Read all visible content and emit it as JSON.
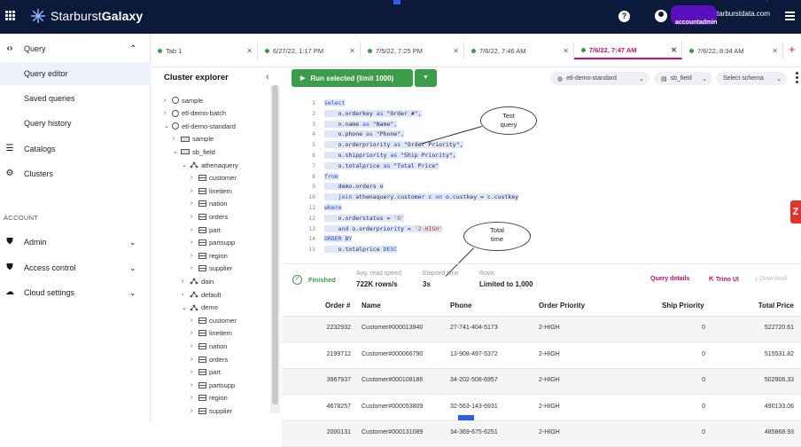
{
  "header": {
    "brand_light": "Starburst",
    "brand_bold": "Galaxy",
    "help": "?",
    "email_domain": "tarburstdata.com",
    "account": "accountadmin"
  },
  "sidebar": {
    "items": [
      {
        "label": "Query",
        "icon": "code-icon"
      },
      {
        "label": "Query editor"
      },
      {
        "label": "Saved queries"
      },
      {
        "label": "Query history"
      },
      {
        "label": "Catalogs",
        "icon": "catalogs-icon"
      },
      {
        "label": "Clusters",
        "icon": "clusters-icon"
      }
    ],
    "section": "ACCOUNT",
    "account_items": [
      {
        "label": "Admin",
        "icon": "shield-icon"
      },
      {
        "label": "Access control",
        "icon": "shield-icon"
      },
      {
        "label": "Cloud settings",
        "icon": "cloud-icon"
      }
    ]
  },
  "tabs": [
    {
      "label": "Tab 1"
    },
    {
      "label": "6/27/22, 1:17 PM"
    },
    {
      "label": "7/5/22, 7:25 PM"
    },
    {
      "label": "7/6/22, 7:46 AM"
    },
    {
      "label": "7/6/22, 7:47 AM"
    },
    {
      "label": "7/6/22, 8:34 AM"
    }
  ],
  "explorer": {
    "title": "Cluster explorer",
    "tree": [
      {
        "label": "sample",
        "icon": "catalog-icon",
        "level": 0,
        "exp": "›"
      },
      {
        "label": "etl-demo-batch",
        "icon": "catalog-icon",
        "level": 0,
        "exp": "›"
      },
      {
        "label": "etl-demo-standard",
        "icon": "catalog-icon",
        "level": 0,
        "exp": "⌄"
      },
      {
        "label": "sample",
        "icon": "schema-icon",
        "level": 1,
        "exp": "›"
      },
      {
        "label": "sb_field",
        "icon": "schema-icon",
        "level": 1,
        "exp": "⌄"
      },
      {
        "label": "athenaquery",
        "icon": "folder-icon",
        "level": 2,
        "exp": "⌄"
      },
      {
        "label": "customer",
        "icon": "table-icon",
        "level": 3,
        "exp": "›"
      },
      {
        "label": "lineitem",
        "icon": "table-icon",
        "level": 3,
        "exp": "›"
      },
      {
        "label": "nation",
        "icon": "table-icon",
        "level": 3,
        "exp": "›"
      },
      {
        "label": "orders",
        "icon": "table-icon",
        "level": 3,
        "exp": "›"
      },
      {
        "label": "part",
        "icon": "table-icon",
        "level": 3,
        "exp": "›"
      },
      {
        "label": "partsupp",
        "icon": "table-icon",
        "level": 3,
        "exp": "›"
      },
      {
        "label": "region",
        "icon": "table-icon",
        "level": 3,
        "exp": "›"
      },
      {
        "label": "supplier",
        "icon": "table-icon",
        "level": 3,
        "exp": "›"
      },
      {
        "label": "dain",
        "icon": "folder-icon",
        "level": 2,
        "exp": "›"
      },
      {
        "label": "default",
        "icon": "folder-icon",
        "level": 2,
        "exp": "›"
      },
      {
        "label": "demo",
        "icon": "folder-icon",
        "level": 2,
        "exp": "⌄"
      },
      {
        "label": "customer",
        "icon": "table-icon",
        "level": 3,
        "exp": "›"
      },
      {
        "label": "lineitem",
        "icon": "table-icon",
        "level": 3,
        "exp": "›"
      },
      {
        "label": "nation",
        "icon": "table-icon",
        "level": 3,
        "exp": "›"
      },
      {
        "label": "orders",
        "icon": "table-icon",
        "level": 3,
        "exp": "›"
      },
      {
        "label": "part",
        "icon": "table-icon",
        "level": 3,
        "exp": "›"
      },
      {
        "label": "partsupp",
        "icon": "table-icon",
        "level": 3,
        "exp": "›"
      },
      {
        "label": "region",
        "icon": "table-icon",
        "level": 3,
        "exp": "›"
      },
      {
        "label": "supplier",
        "icon": "table-icon",
        "level": 3,
        "exp": "›"
      }
    ]
  },
  "toolbar": {
    "run_label": "Run selected (limit 1000)",
    "cluster": "etl-demo-standard",
    "catalog": "sb_field",
    "schema_placeholder": "Select schema"
  },
  "editor": {
    "lines": [
      "select",
      "    o.orderkey as \"Order #\",",
      "    o.name as \"Name\",",
      "    o.phone as \"Phone\",",
      "    o.orderpriority as \"Order Priority\",",
      "    o.shippriority as \"Ship Priority\",",
      "    o.totalprice as \"Total Price\"",
      "from",
      "    demo.orders o",
      "    join athenaquery.customer c on o.custkey = c.custkey",
      "where",
      "    o.orderstatus = 'O'",
      "    and o.orderpriority = '2-HIGH'",
      "ORDER BY",
      "    o.totalprice DESC"
    ],
    "callout_query": "Test query",
    "callout_time": "Total time"
  },
  "status": {
    "state": "Finished",
    "speed_label": "Avg. read speed",
    "speed_value": "722K rows/s",
    "elapsed_label": "Elapsed time",
    "elapsed_value": "3s",
    "rows_label": "Rows",
    "rows_value": "Limited to 1,000",
    "query_details": "Query details",
    "trino_ui": "Trino UI",
    "download": "Download"
  },
  "results": {
    "columns": [
      "Order #",
      "Name",
      "Phone",
      "Order Priority",
      "Ship Priority",
      "Total Price"
    ],
    "rows": [
      [
        "2232932",
        "Customer#000013940",
        "27-741-404-5173",
        "2-HIGH",
        "0",
        "522720.61"
      ],
      [
        "2199712",
        "Customer#000066790",
        "13-908-497-5372",
        "2-HIGH",
        "0",
        "515531.82"
      ],
      [
        "3967937",
        "Customer#000108186",
        "34-202-508-6957",
        "2-HIGH",
        "0",
        "502906.33"
      ],
      [
        "4678257",
        "Customer#000053809",
        "32-563-143-6931",
        "2-HIGH",
        "0",
        "490133.06"
      ],
      [
        "2000131",
        "Customer#000131089",
        "34-369-675-6251",
        "2-HIGH",
        "0",
        "485868.93"
      ]
    ]
  },
  "red_tab": "Z",
  "colors": {
    "topbar": "#0b1a3a",
    "accent": "#c80f6e",
    "run": "#3b9c49"
  }
}
